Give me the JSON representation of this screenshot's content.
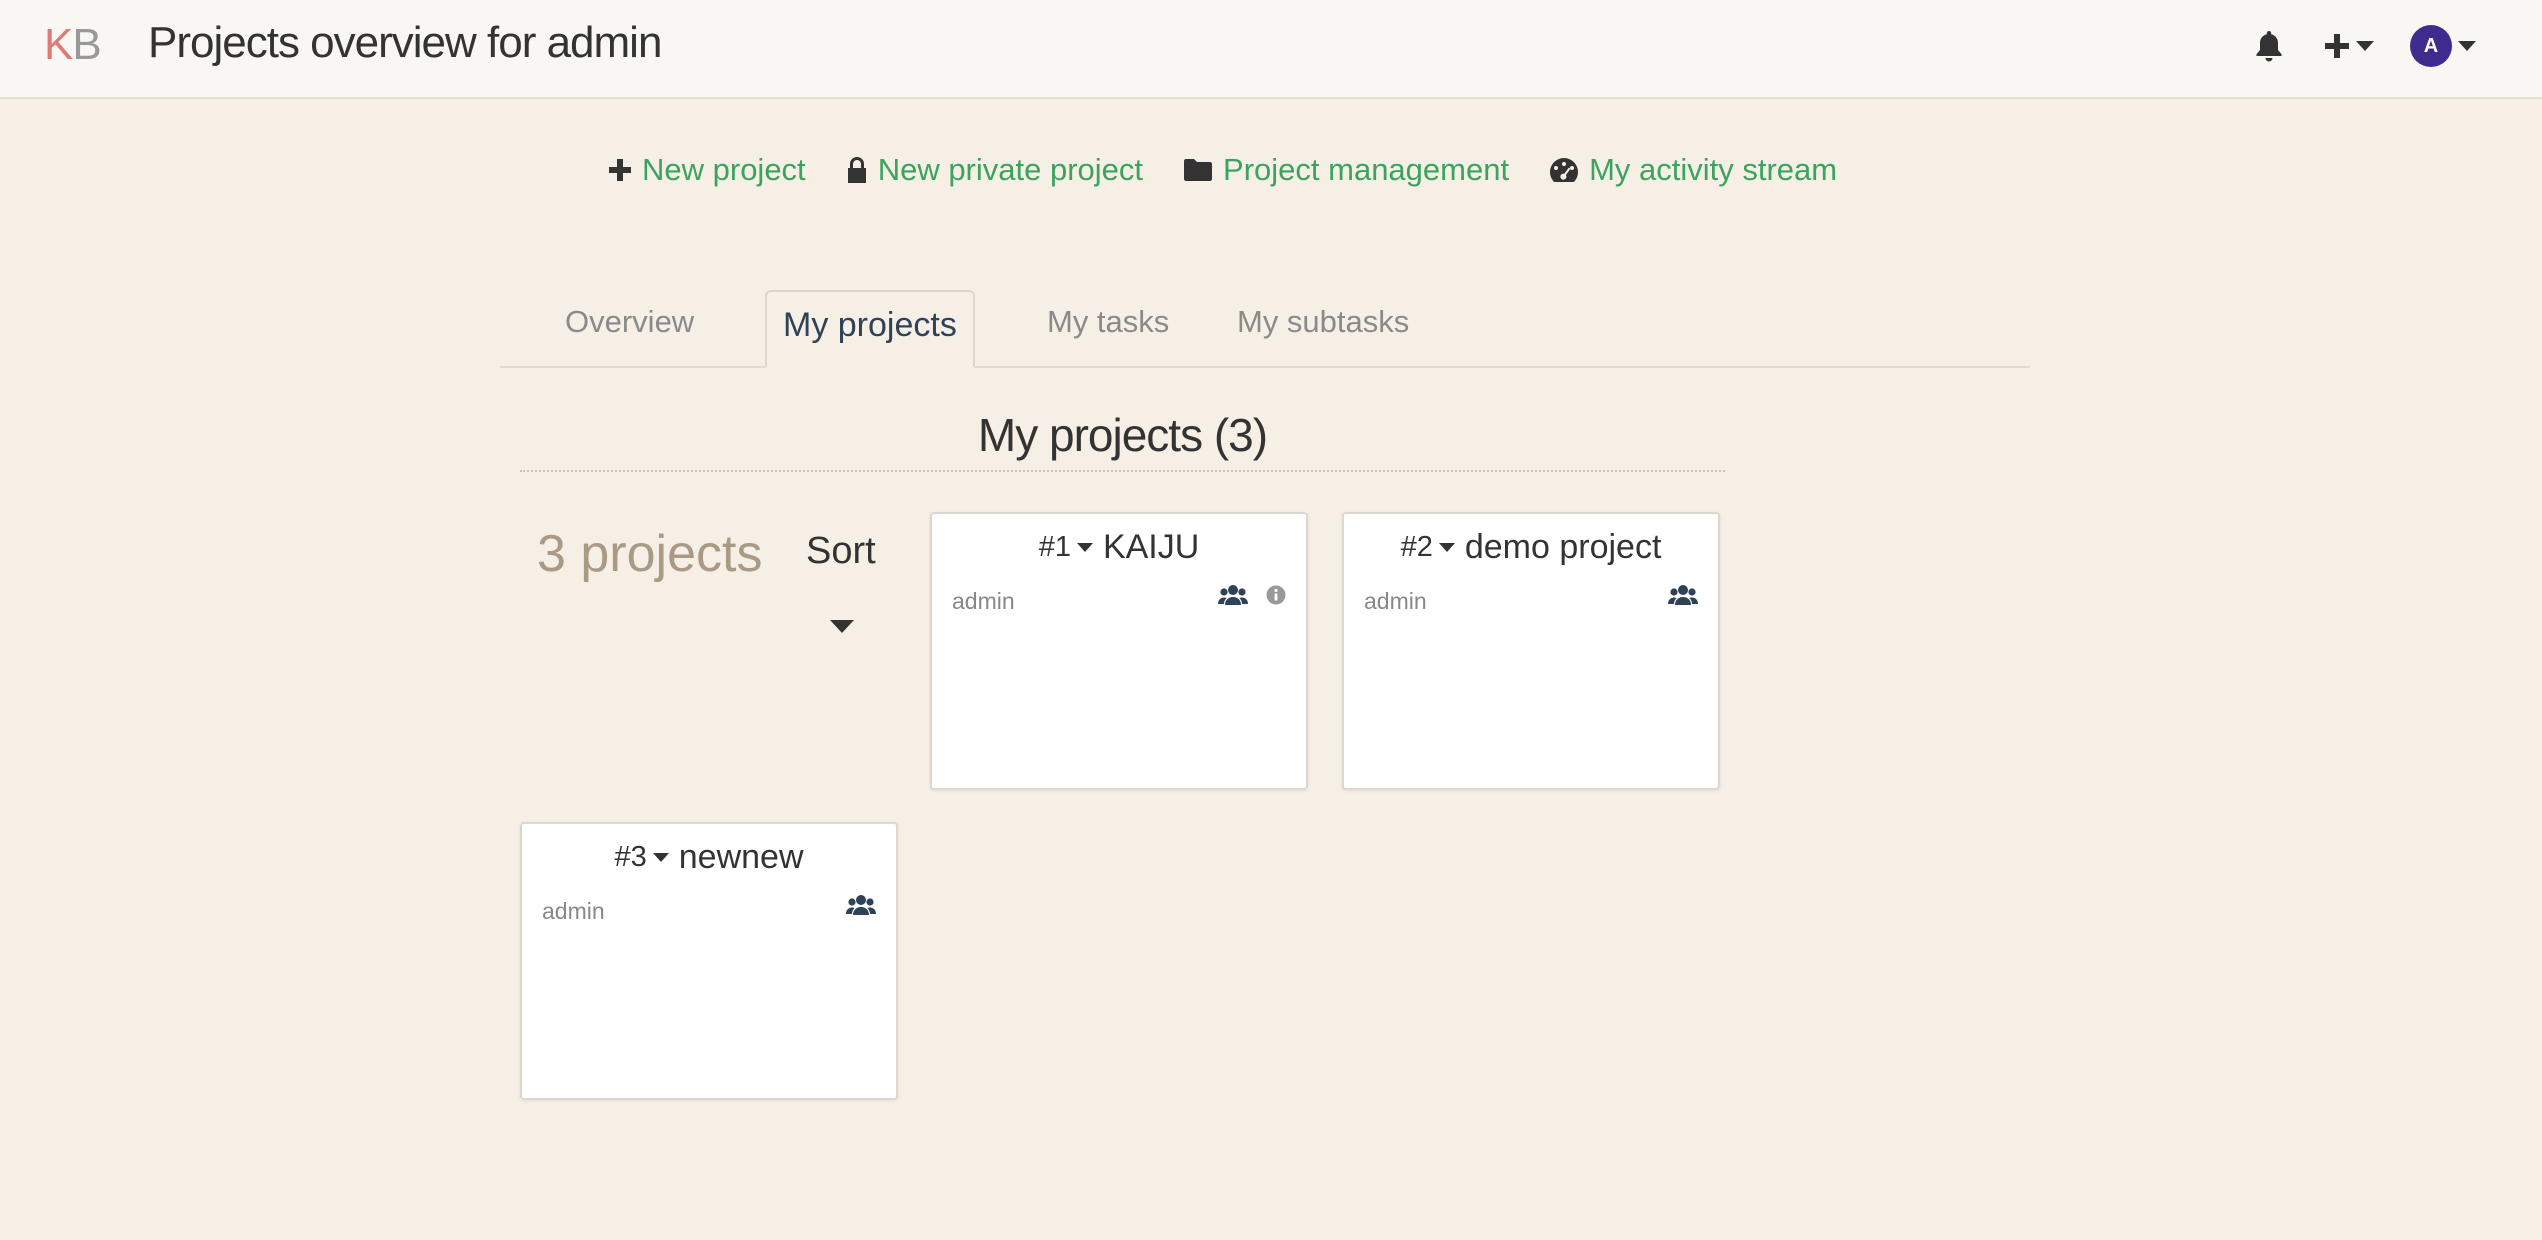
{
  "header": {
    "logo_k": "K",
    "logo_b": "B",
    "title": "Projects overview for admin",
    "avatar_letter": "A"
  },
  "actions": [
    {
      "label": "New project",
      "icon": "plus-icon"
    },
    {
      "label": "New private project",
      "icon": "lock-icon"
    },
    {
      "label": "Project management",
      "icon": "folder-icon"
    },
    {
      "label": "My activity stream",
      "icon": "dashboard-icon"
    }
  ],
  "tabs": [
    {
      "label": "Overview",
      "active": false
    },
    {
      "label": "My projects",
      "active": true
    },
    {
      "label": "My tasks",
      "active": false
    },
    {
      "label": "My subtasks",
      "active": false
    }
  ],
  "section": {
    "title": "My projects (3)"
  },
  "sidebar": {
    "count": "3 projects",
    "sort_label": "Sort"
  },
  "projects": [
    {
      "id": "#1",
      "name": "KAIJU",
      "owner": "admin",
      "icons": [
        "users-icon",
        "info-icon"
      ]
    },
    {
      "id": "#2",
      "name": "demo project",
      "owner": "admin",
      "icons": [
        "users-icon"
      ]
    },
    {
      "id": "#3",
      "name": "newnew",
      "owner": "admin",
      "icons": [
        "users-icon"
      ]
    }
  ],
  "colors": {
    "background": "#f6efe6",
    "header": "#f8f7f4",
    "link": "#3aa45f",
    "logo_k": "#e07a75",
    "avatar": "#3d2b8e",
    "icon": "#2f4256"
  }
}
